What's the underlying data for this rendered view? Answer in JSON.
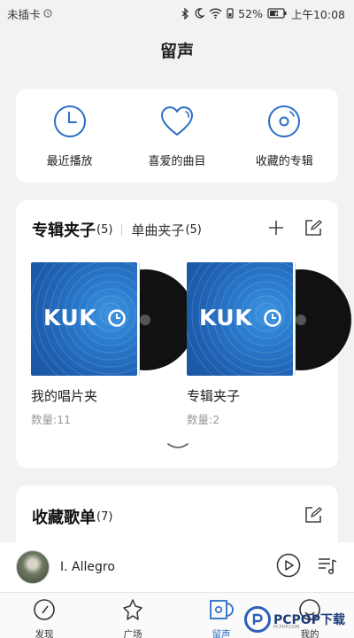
{
  "status_bar": {
    "carrier": "未插卡",
    "battery": "52%",
    "time": "上午10:08"
  },
  "header": {
    "title": "留声"
  },
  "quick_access": [
    {
      "label": "最近播放",
      "icon": "clock-icon"
    },
    {
      "label": "喜爱的曲目",
      "icon": "heart-icon"
    },
    {
      "label": "收藏的专辑",
      "icon": "disc-icon"
    }
  ],
  "album_folders": {
    "tab_active": "专辑夹子",
    "tab_active_count": "(5)",
    "tab_inactive": "单曲夹子",
    "tab_inactive_count": "(5)",
    "items": [
      {
        "name": "我的唱片夹",
        "count": "数量:11",
        "cover_text": "KUK"
      },
      {
        "name": "专辑夹子",
        "count": "数量:2",
        "cover_text": "KUK"
      }
    ]
  },
  "playlists": {
    "title": "收藏歌单",
    "count": "(7)"
  },
  "player": {
    "track": "I. Allegro"
  },
  "nav": [
    {
      "label": "发现",
      "icon": "compass-icon",
      "active": false
    },
    {
      "label": "广场",
      "icon": "star-icon",
      "active": false
    },
    {
      "label": "留声",
      "icon": "vinyl-folder-icon",
      "active": true
    },
    {
      "label": "我的",
      "icon": "profile-icon",
      "active": false
    }
  ],
  "watermark": {
    "brand": "PCPOP下载",
    "sub": "PCPOP.COM"
  },
  "colors": {
    "accent": "#2a6fc6",
    "card_bg": "#ffffff",
    "page_bg": "#f2f2f4",
    "cover_blue": "#1e5fb0"
  }
}
